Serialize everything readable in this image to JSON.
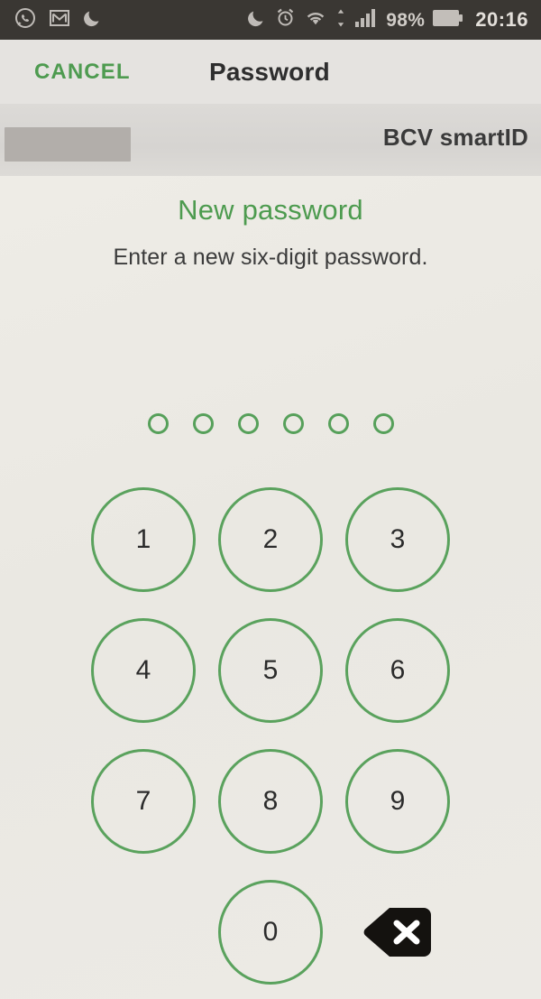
{
  "status_bar": {
    "left_icons": [
      "whatsapp-icon",
      "gmail-icon",
      "do-not-disturb-moon-icon"
    ],
    "right_icons": [
      "moon-icon",
      "alarm-clock-icon",
      "wifi-icon",
      "mobile-data-arrows-icon",
      "signal-bars-icon",
      "battery-icon"
    ],
    "battery_percent": "98%",
    "clock": "20:16",
    "background_color": "#3a3733"
  },
  "appbar": {
    "cancel_label": "CANCEL",
    "title": "Password",
    "cancel_color": "#4e9b50"
  },
  "subbar": {
    "redacted_field": "",
    "brand": "BCV smartID"
  },
  "content": {
    "heading": "New password",
    "subheading": "Enter a new six-digit password.",
    "heading_color": "#4d9b4f",
    "accent_color": "#56a05a"
  },
  "pin": {
    "length": 6,
    "entered": 0,
    "dots": [
      "empty",
      "empty",
      "empty",
      "empty",
      "empty",
      "empty"
    ]
  },
  "keypad": {
    "rows": [
      [
        "1",
        "2",
        "3"
      ],
      [
        "4",
        "5",
        "6"
      ],
      [
        "7",
        "8",
        "9"
      ],
      [
        "",
        "0",
        "backspace"
      ]
    ],
    "backspace_icon": "backspace-delete-icon"
  }
}
